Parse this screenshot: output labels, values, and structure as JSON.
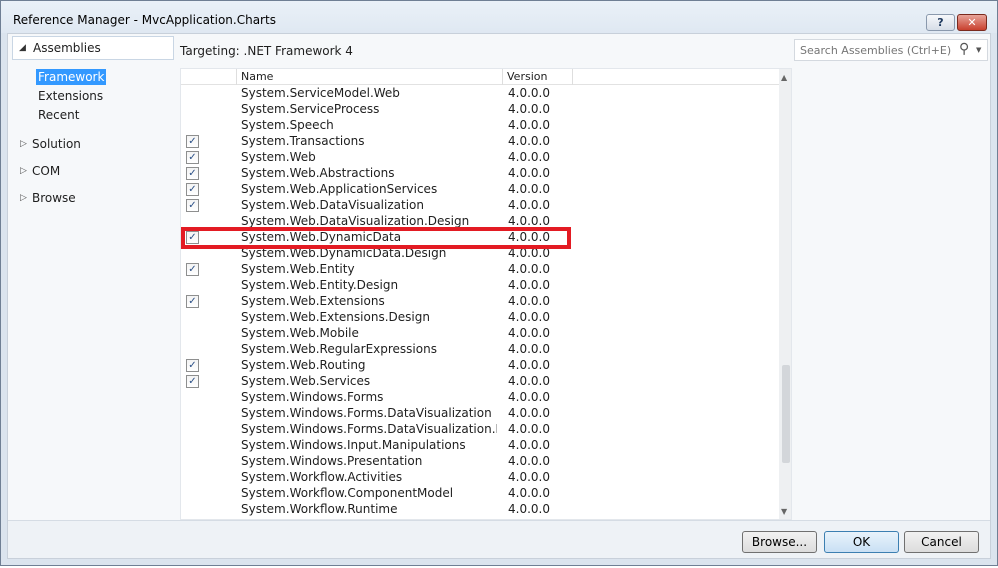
{
  "window": {
    "title": "Reference Manager - MvcApplication.Charts",
    "help_icon": "?",
    "close_icon": "✕"
  },
  "nav": {
    "root_label": "Assemblies",
    "sub_items": [
      "Framework",
      "Extensions",
      "Recent"
    ],
    "collapsed": [
      "Solution",
      "COM",
      "Browse"
    ]
  },
  "targeting": "Targeting: .NET Framework 4",
  "search": {
    "placeholder": "Search Assemblies (Ctrl+E)",
    "icon": "search-icon"
  },
  "list": {
    "columns": [
      "Name",
      "Version"
    ],
    "rows": [
      {
        "name": "System.ServiceModel.Web",
        "version": "4.0.0.0",
        "checked": false
      },
      {
        "name": "System.ServiceProcess",
        "version": "4.0.0.0",
        "checked": false
      },
      {
        "name": "System.Speech",
        "version": "4.0.0.0",
        "checked": false
      },
      {
        "name": "System.Transactions",
        "version": "4.0.0.0",
        "checked": true
      },
      {
        "name": "System.Web",
        "version": "4.0.0.0",
        "checked": true
      },
      {
        "name": "System.Web.Abstractions",
        "version": "4.0.0.0",
        "checked": true
      },
      {
        "name": "System.Web.ApplicationServices",
        "version": "4.0.0.0",
        "checked": true
      },
      {
        "name": "System.Web.DataVisualization",
        "version": "4.0.0.0",
        "checked": true
      },
      {
        "name": "System.Web.DataVisualization.Design",
        "version": "4.0.0.0",
        "checked": false
      },
      {
        "name": "System.Web.DynamicData",
        "version": "4.0.0.0",
        "checked": true
      },
      {
        "name": "System.Web.DynamicData.Design",
        "version": "4.0.0.0",
        "checked": false
      },
      {
        "name": "System.Web.Entity",
        "version": "4.0.0.0",
        "checked": true
      },
      {
        "name": "System.Web.Entity.Design",
        "version": "4.0.0.0",
        "checked": false
      },
      {
        "name": "System.Web.Extensions",
        "version": "4.0.0.0",
        "checked": true
      },
      {
        "name": "System.Web.Extensions.Design",
        "version": "4.0.0.0",
        "checked": false
      },
      {
        "name": "System.Web.Mobile",
        "version": "4.0.0.0",
        "checked": false
      },
      {
        "name": "System.Web.RegularExpressions",
        "version": "4.0.0.0",
        "checked": false
      },
      {
        "name": "System.Web.Routing",
        "version": "4.0.0.0",
        "checked": true
      },
      {
        "name": "System.Web.Services",
        "version": "4.0.0.0",
        "checked": true
      },
      {
        "name": "System.Windows.Forms",
        "version": "4.0.0.0",
        "checked": false
      },
      {
        "name": "System.Windows.Forms.DataVisualization",
        "version": "4.0.0.0",
        "checked": false
      },
      {
        "name": "System.Windows.Forms.DataVisualization.Desi...",
        "version": "4.0.0.0",
        "checked": false
      },
      {
        "name": "System.Windows.Input.Manipulations",
        "version": "4.0.0.0",
        "checked": false
      },
      {
        "name": "System.Windows.Presentation",
        "version": "4.0.0.0",
        "checked": false
      },
      {
        "name": "System.Workflow.Activities",
        "version": "4.0.0.0",
        "checked": false
      },
      {
        "name": "System.Workflow.ComponentModel",
        "version": "4.0.0.0",
        "checked": false
      },
      {
        "name": "System.Workflow.Runtime",
        "version": "4.0.0.0",
        "checked": false
      }
    ]
  },
  "buttons": {
    "browse": "Browse...",
    "ok": "OK",
    "cancel": "Cancel"
  },
  "colors": {
    "highlight_box": "#e31b23",
    "selection": "#3399ff"
  }
}
